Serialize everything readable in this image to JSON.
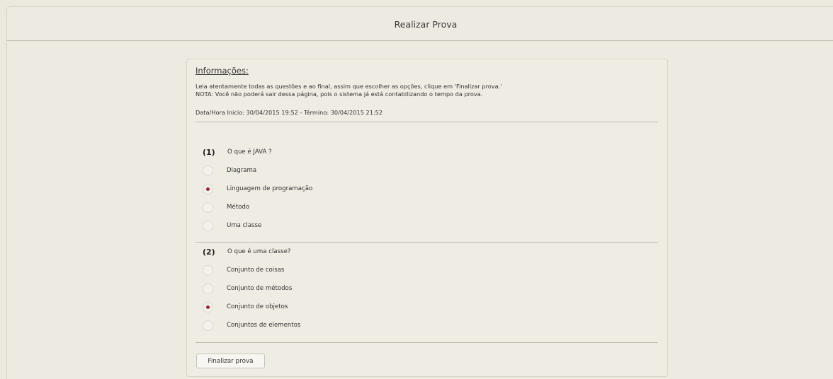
{
  "header": {
    "title": "Realizar Prova"
  },
  "info": {
    "title": "Informações:",
    "line1": "Leia atentamente todas as questões e ao final, assim que escolher as opções, clique em 'Finalizar prova.'",
    "line2": "NOTA: Você não poderá sair dessa página, pois o sistema já está contabilizando o tempo da prova.",
    "dates": "Data/Hora Inicio: 30/04/2015 19:52 - Término: 30/04/2015 21:52"
  },
  "questions": [
    {
      "number": "(1)",
      "text": "O que é JAVA ?",
      "options": [
        {
          "label": "Diagrama",
          "selected": false
        },
        {
          "label": "Linguagem de programação",
          "selected": true
        },
        {
          "label": "Método",
          "selected": false
        },
        {
          "label": "Uma classe",
          "selected": false
        }
      ]
    },
    {
      "number": "(2)",
      "text": "O que é uma classe?",
      "options": [
        {
          "label": "Conjunto de coisas",
          "selected": false
        },
        {
          "label": "Conjunto de métodos",
          "selected": false
        },
        {
          "label": "Conjunto de objetos",
          "selected": true
        },
        {
          "label": "Conjuntos de elementos",
          "selected": false
        }
      ]
    }
  ],
  "submit_label": "Finalizar prova",
  "colors": {
    "background": "#ebe8df",
    "selected_dot": "#9a2a2a",
    "divider": "#bdb9ad"
  }
}
